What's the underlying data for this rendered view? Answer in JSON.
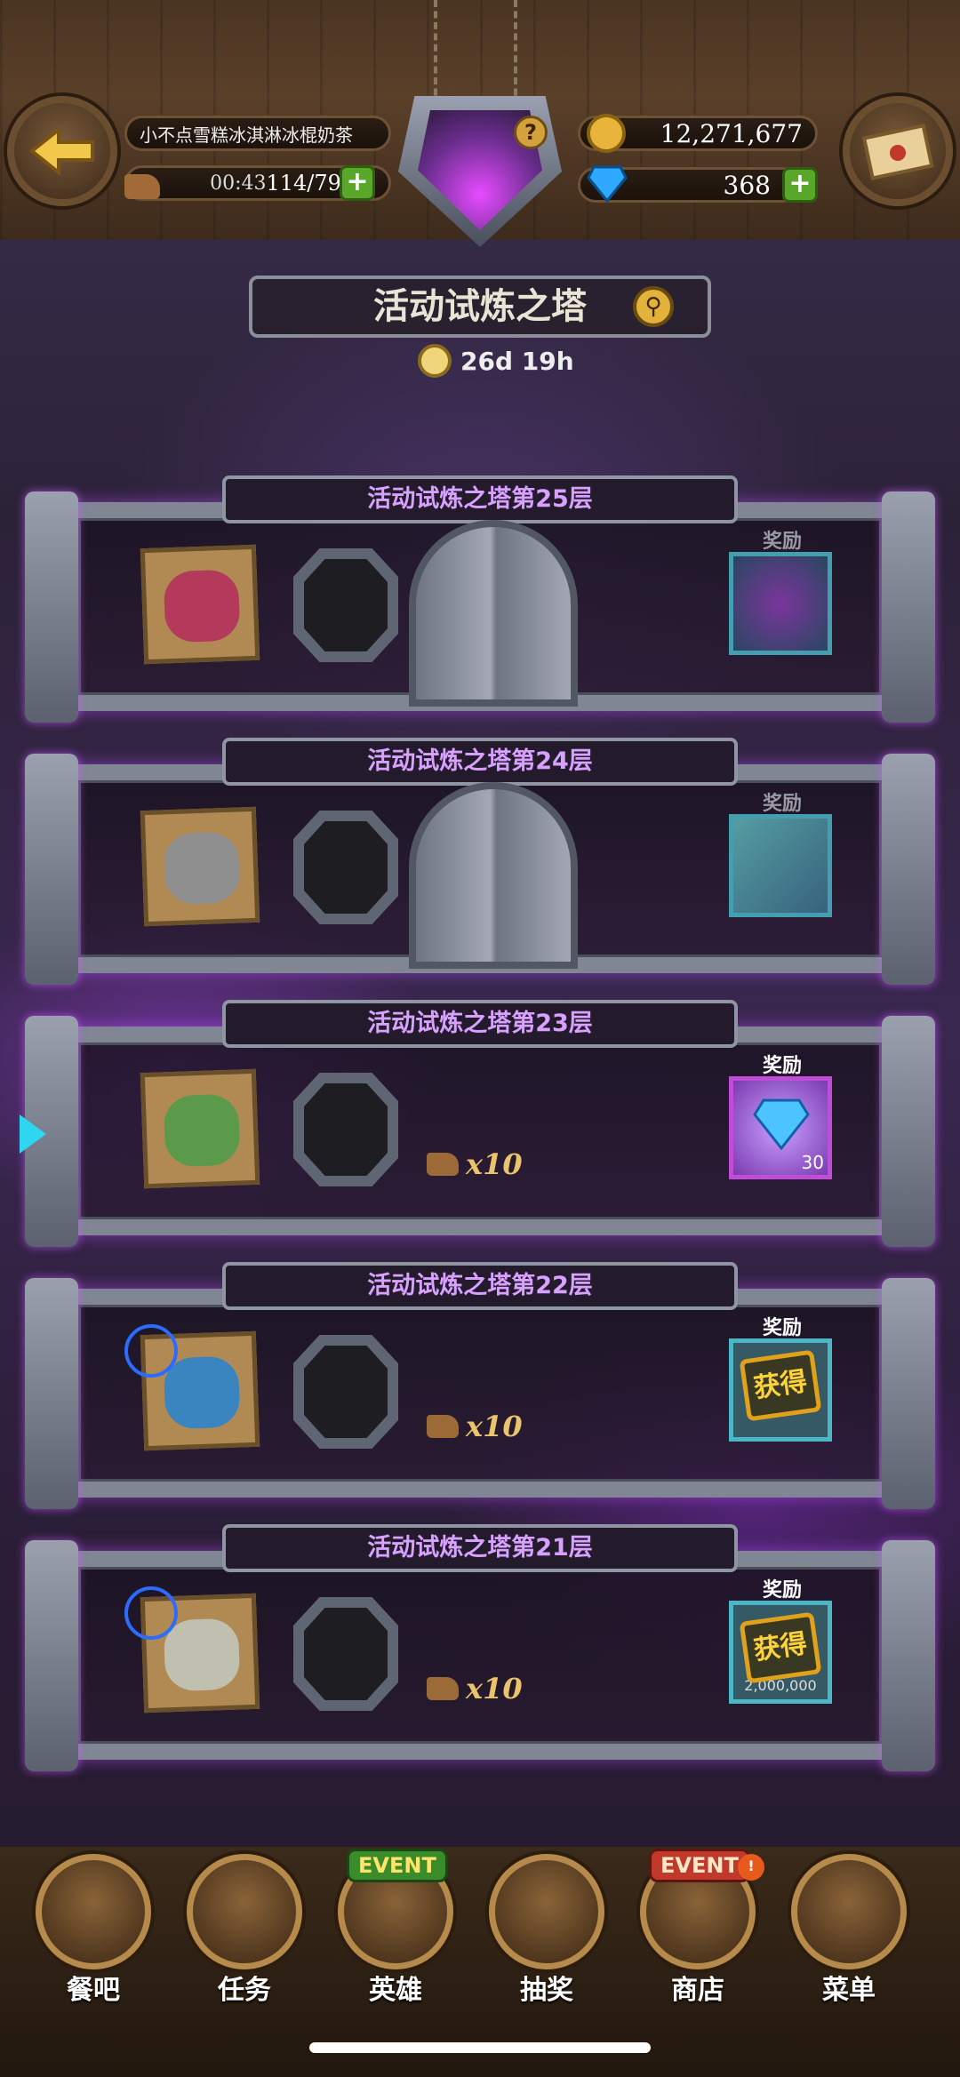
{
  "header": {
    "player_name": "小不点雪糕冰淇淋冰棍奶茶",
    "stamina_timer": "00:43",
    "stamina": "114/79",
    "gold": "12,271,677",
    "gems": "368",
    "help": "?"
  },
  "event": {
    "title": "活动试炼之塔",
    "time_left": "26d 19h"
  },
  "reward_label": "奖励",
  "floors": [
    {
      "title": "活动试炼之塔第25层",
      "locked": true,
      "reward_value": ""
    },
    {
      "title": "活动试炼之塔第24层",
      "locked": true,
      "reward_value": ""
    },
    {
      "title": "活动试炼之塔第23层",
      "locked": false,
      "cost": "x10",
      "reward_value": "30"
    },
    {
      "title": "活动试炼之塔第22层",
      "locked": false,
      "cost": "x10",
      "obtained": "获得",
      "reward_value": ""
    },
    {
      "title": "活动试炼之塔第21层",
      "locked": false,
      "cost": "x10",
      "obtained": "获得",
      "reward_value": "2,000,000"
    }
  ],
  "nav": [
    {
      "label": "餐吧"
    },
    {
      "label": "任务"
    },
    {
      "label": "英雄",
      "badge": "EVENT"
    },
    {
      "label": "抽奖"
    },
    {
      "label": "商店",
      "badge": "EVENT"
    },
    {
      "label": "菜单"
    }
  ],
  "colors": {
    "floor_title": "#d8a0ff",
    "accent_purple": "#b04dff",
    "plus_green": "#5aa82a",
    "stamp_gold": "#ffd23a"
  }
}
